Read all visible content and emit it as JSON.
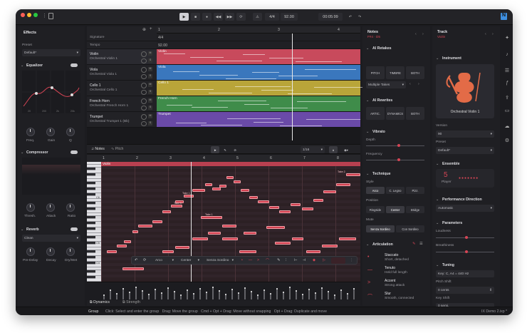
{
  "transport": {
    "signature": "4/4",
    "tempo": "92.00",
    "time": "00:05:99"
  },
  "effects": {
    "title": "Effects",
    "preset_label": "Preset",
    "preset_value": "Default*",
    "equalizer": {
      "title": "Equalizer",
      "knobs": [
        "Freq.",
        "Gain",
        "Q"
      ],
      "axis": [
        "20",
        "200",
        "2k",
        "20k"
      ]
    },
    "compressor": {
      "title": "Compressor",
      "knobs": [
        "Thresh.",
        "Attack",
        "Ratio"
      ]
    },
    "reverb": {
      "title": "Reverb",
      "type": "Clean",
      "knobs": [
        "Pre-Delay",
        "Decay",
        "Dry/Wet"
      ]
    }
  },
  "tracks_header": {
    "signature_label": "Signature",
    "tempo_label": "Tempo",
    "signature_value": "4/4",
    "tempo_value": "92.00"
  },
  "tracks": [
    {
      "name": "Violin",
      "sub": "Orchestral Violin 1",
      "clip": "Violin",
      "color": "#c84a5c"
    },
    {
      "name": "Viola",
      "sub": "Orchestral Viola 1",
      "clip": "Viola",
      "color": "#3a77bd"
    },
    {
      "name": "Cello 1",
      "sub": "Orchestral Cello 1",
      "clip": "Cello 1",
      "color": "#b9a539"
    },
    {
      "name": "French Horn",
      "sub": "Orchestral French Horn 1",
      "clip": "French Horn",
      "color": "#3f8c4a"
    },
    {
      "name": "Trumpet",
      "sub": "Orchestral Trumpet 1 (Bb)",
      "clip": "Trumpet",
      "color": "#6a4aa8"
    }
  ],
  "ruler": [
    "1",
    "2",
    "3",
    "4"
  ],
  "piano_ruler": [
    "1",
    "2",
    "3",
    "4",
    "5",
    "6",
    "7",
    "8"
  ],
  "piano": {
    "tab_notes": "Notes",
    "tab_pitch": "Pitch",
    "quantize": "1/16",
    "clip_label": "Violin",
    "key_labels": [
      "C6",
      "C5",
      "C4"
    ],
    "note_labels": [
      "Take 1",
      "Take 2",
      "Take 3",
      "Take 1"
    ],
    "toolbar": [
      "Arco",
      "Center",
      "Senza Sordino"
    ],
    "tab_dynamics": "Dynamics",
    "tab_strength": "Strength"
  },
  "notes_panel": {
    "title": "Notes",
    "subtitle": "F#4 · D5",
    "ai_retakes": "AI Retakes",
    "retake_buttons": [
      "PITCH",
      "TIMBRE",
      "BOTH"
    ],
    "multiple_takes": "Multiple Takes",
    "ai_rewrites": "AI Rewrites",
    "rewrite_buttons": [
      "ARTIC.",
      "DYNAMICS",
      "BOTH"
    ],
    "vibrato": "Vibrato",
    "depth": "Depth",
    "frequency": "Frequency",
    "technique": "Technique",
    "style": "Style",
    "style_buttons": [
      "Arco",
      "C. Legno",
      "Pizz."
    ],
    "position": "Position",
    "position_buttons": [
      "Ringside",
      "Center",
      "Bridge"
    ],
    "mute": "Mute",
    "mute_buttons": [
      "Senza Sordino",
      "Con Sordino"
    ],
    "articulation": "Articulation",
    "articulations": [
      {
        "name": "Staccato",
        "desc": "Short, detached"
      },
      {
        "name": "Tenuto",
        "desc": "Held full length"
      },
      {
        "name": "Accent",
        "desc": "Strong attack"
      },
      {
        "name": "Slur",
        "desc": "Smooth, connected"
      }
    ]
  },
  "track_panel": {
    "title": "Track",
    "subtitle": "Violin",
    "instrument": "Instrument",
    "instrument_name": "Orchestral Violin 1",
    "version_label": "Version",
    "version": "90",
    "preset_label": "Preset",
    "preset": "Default*",
    "ensemble": "Ensemble",
    "players": "5",
    "players_label": "Player",
    "direction": "Performance Direction",
    "direction_value": "Automatic",
    "parameters": "Parameters",
    "loudness": "Loudness",
    "breathiness": "Breathiness",
    "tuning": "Tuning",
    "tuning_value": "Key: C, A4 = 440 Hz",
    "pitch_shift": "Pitch Shift",
    "pitch_shift_value": "0 cents",
    "key_shift": "Key Shift",
    "key_shift_value": "0 semi."
  },
  "status": {
    "group": "Group",
    "hints": "Click: Select and enter the group   Drag: Move the group   Cmd + Opt + Drag: Move without snapping   Opt + Drag: Duplicate and move",
    "project": "IX Demo 2.ixp *"
  }
}
